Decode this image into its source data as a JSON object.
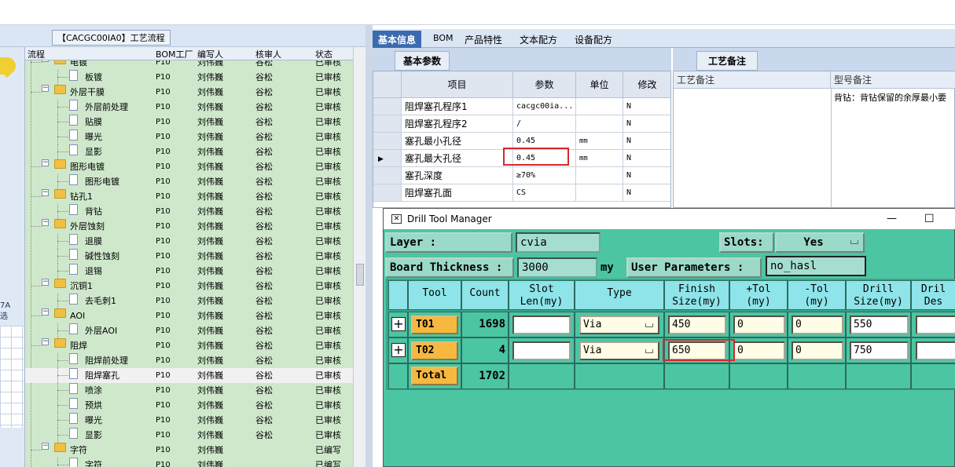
{
  "left_panel": {
    "title": "【CACGC00IA0】工艺流程",
    "side_label": "7A\n选",
    "columns": [
      "流程",
      "BOM工厂",
      "编写人",
      "核审人",
      "状态"
    ],
    "rows": [
      {
        "name": "电镀",
        "type": "folder",
        "level": 1,
        "bom": "P10",
        "writer": "刘伟巍",
        "reviewer": "谷松",
        "status": "已审核",
        "partial": true
      },
      {
        "name": "板镀",
        "type": "doc",
        "level": 2,
        "bom": "P10",
        "writer": "刘伟巍",
        "reviewer": "谷松",
        "status": "已审核"
      },
      {
        "name": "外层干膜",
        "type": "folder",
        "level": 1,
        "bom": "P10",
        "writer": "刘伟巍",
        "reviewer": "谷松",
        "status": "已审核"
      },
      {
        "name": "外层前处理",
        "type": "doc",
        "level": 2,
        "bom": "P10",
        "writer": "刘伟巍",
        "reviewer": "谷松",
        "status": "已审核"
      },
      {
        "name": "贴膜",
        "type": "doc",
        "level": 2,
        "bom": "P10",
        "writer": "刘伟巍",
        "reviewer": "谷松",
        "status": "已审核"
      },
      {
        "name": "曝光",
        "type": "doc",
        "level": 2,
        "bom": "P10",
        "writer": "刘伟巍",
        "reviewer": "谷松",
        "status": "已审核"
      },
      {
        "name": "显影",
        "type": "doc",
        "level": 2,
        "bom": "P10",
        "writer": "刘伟巍",
        "reviewer": "谷松",
        "status": "已审核"
      },
      {
        "name": "图形电镀",
        "type": "folder",
        "level": 1,
        "bom": "P10",
        "writer": "刘伟巍",
        "reviewer": "谷松",
        "status": "已审核"
      },
      {
        "name": "图形电镀",
        "type": "doc",
        "level": 2,
        "bom": "P10",
        "writer": "刘伟巍",
        "reviewer": "谷松",
        "status": "已审核"
      },
      {
        "name": "钻孔1",
        "type": "folder",
        "level": 1,
        "bom": "P10",
        "writer": "刘伟巍",
        "reviewer": "谷松",
        "status": "已审核"
      },
      {
        "name": "背钻",
        "type": "doc",
        "level": 2,
        "bom": "P10",
        "writer": "刘伟巍",
        "reviewer": "谷松",
        "status": "已审核"
      },
      {
        "name": "外层蚀刻",
        "type": "folder",
        "level": 1,
        "bom": "P10",
        "writer": "刘伟巍",
        "reviewer": "谷松",
        "status": "已审核"
      },
      {
        "name": "退膜",
        "type": "doc",
        "level": 2,
        "bom": "P10",
        "writer": "刘伟巍",
        "reviewer": "谷松",
        "status": "已审核"
      },
      {
        "name": "碱性蚀刻",
        "type": "doc",
        "level": 2,
        "bom": "P10",
        "writer": "刘伟巍",
        "reviewer": "谷松",
        "status": "已审核"
      },
      {
        "name": "退锡",
        "type": "doc",
        "level": 2,
        "bom": "P10",
        "writer": "刘伟巍",
        "reviewer": "谷松",
        "status": "已审核"
      },
      {
        "name": "沉铜1",
        "type": "folder",
        "level": 1,
        "bom": "P10",
        "writer": "刘伟巍",
        "reviewer": "谷松",
        "status": "已审核"
      },
      {
        "name": "去毛刺1",
        "type": "doc",
        "level": 2,
        "bom": "P10",
        "writer": "刘伟巍",
        "reviewer": "谷松",
        "status": "已审核"
      },
      {
        "name": "AOI",
        "type": "folder",
        "level": 1,
        "bom": "P10",
        "writer": "刘伟巍",
        "reviewer": "谷松",
        "status": "已审核"
      },
      {
        "name": "外层AOI",
        "type": "doc",
        "level": 2,
        "bom": "P10",
        "writer": "刘伟巍",
        "reviewer": "谷松",
        "status": "已审核"
      },
      {
        "name": "阻焊",
        "type": "folder",
        "level": 1,
        "bom": "P10",
        "writer": "刘伟巍",
        "reviewer": "谷松",
        "status": "已审核"
      },
      {
        "name": "阻焊前处理",
        "type": "doc",
        "level": 2,
        "bom": "P10",
        "writer": "刘伟巍",
        "reviewer": "谷松",
        "status": "已审核"
      },
      {
        "name": "阻焊塞孔",
        "type": "doc",
        "level": 2,
        "bom": "P10",
        "writer": "刘伟巍",
        "reviewer": "谷松",
        "status": "已审核",
        "selected": true
      },
      {
        "name": "喷涂",
        "type": "doc",
        "level": 2,
        "bom": "P10",
        "writer": "刘伟巍",
        "reviewer": "谷松",
        "status": "已审核"
      },
      {
        "name": "预烘",
        "type": "doc",
        "level": 2,
        "bom": "P10",
        "writer": "刘伟巍",
        "reviewer": "谷松",
        "status": "已审核"
      },
      {
        "name": "曝光",
        "type": "doc",
        "level": 2,
        "bom": "P10",
        "writer": "刘伟巍",
        "reviewer": "谷松",
        "status": "已审核"
      },
      {
        "name": "显影",
        "type": "doc",
        "level": 2,
        "bom": "P10",
        "writer": "刘伟巍",
        "reviewer": "谷松",
        "status": "已审核"
      },
      {
        "name": "字符",
        "type": "folder",
        "level": 1,
        "bom": "P10",
        "writer": "刘伟巍",
        "reviewer": "",
        "status": "已编写"
      },
      {
        "name": "字符",
        "type": "doc",
        "level": 2,
        "bom": "P10",
        "writer": "刘伟巍",
        "reviewer": "",
        "status": "已编写"
      }
    ]
  },
  "right_tabs": [
    "基本信息",
    "BOM",
    "产品特性",
    "文本配方",
    "设备配方"
  ],
  "basic_params": {
    "tab": "基本参数",
    "columns": [
      "项目",
      "参数",
      "单位",
      "修改"
    ],
    "rows": [
      {
        "item": "阻焊塞孔程序1",
        "param": "cacgc00ia...",
        "unit": "",
        "mod": "N"
      },
      {
        "item": "阻焊塞孔程序2",
        "param": "/",
        "unit": "",
        "mod": "N"
      },
      {
        "item": "塞孔最小孔径",
        "param": "0.45",
        "unit": "mm",
        "mod": "N"
      },
      {
        "item": "塞孔最大孔径",
        "param": "0.45",
        "unit": "mm",
        "mod": "N",
        "current": true
      },
      {
        "item": "塞孔深度",
        "param": "≥70%",
        "unit": "",
        "mod": "N"
      },
      {
        "item": "阻焊塞孔面",
        "param": "CS",
        "unit": "",
        "mod": "N"
      }
    ]
  },
  "process_notes": {
    "tab": "工艺备注",
    "col1": "工艺备注",
    "col2": "型号备注",
    "model_note": "背钻：背钻保留的余厚最小要"
  },
  "drill_tool_manager": {
    "title": "Drill Tool Manager",
    "minimize": "—",
    "maximize": "☐",
    "layer_label": "Layer :",
    "layer_value": "cvia",
    "slots_label": "Slots:",
    "slots_value": "Yes",
    "board_thickness_label": "Board Thickness :",
    "board_thickness_value": "3000",
    "board_thickness_unit": "my",
    "user_params_label": "User Parameters :",
    "user_params_value": "no_hasl",
    "columns": [
      "Tool",
      "Count",
      "Slot\nLen(my)",
      "Type",
      "Finish\nSize(my)",
      "+Tol\n(my)",
      "-Tol\n(my)",
      "Drill\nSize(my)",
      "Dril\nDes"
    ],
    "tools": [
      {
        "tool": "T01",
        "count": "1698",
        "slot_len": "",
        "type": "Via",
        "finish": "450",
        "plus_tol": "0",
        "minus_tol": "0",
        "drill": "550"
      },
      {
        "tool": "T02",
        "count": "4",
        "slot_len": "",
        "type": "Via",
        "finish": "650",
        "plus_tol": "0",
        "minus_tol": "0",
        "drill": "750"
      }
    ],
    "total_label": "Total",
    "total_count": "1702"
  }
}
